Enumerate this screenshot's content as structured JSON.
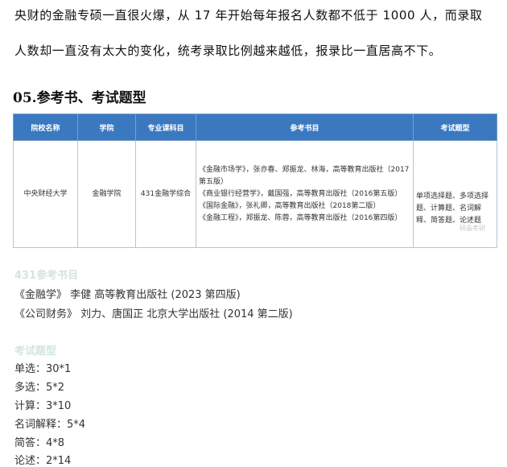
{
  "intro": {
    "line1": "央财的金融专硕一直很火爆，从 17 年开始每年报名人数都不低于 1000 人，而录取",
    "line2": "人数却一直没有太大的变化，统考录取比例越来越低，报录比一直居高不下。"
  },
  "section_title": "05.参考书、考试题型",
  "table": {
    "headers": [
      "院校名称",
      "学院",
      "专业课科目",
      "参考书目",
      "考试题型"
    ],
    "row": {
      "school": "中央财经大学",
      "college": "金融学院",
      "subject": "431金融学综合",
      "books": [
        "《金融市场学》，张亦春、郑振龙、林海，高等教育出版社（2017第五版）",
        "《商业银行经营学》，戴国强，高等教育出版社（2016第五版）",
        "《国际金融》，张礼卿，高等教育出版社（2018第二版）",
        "《金融工程》，郑振龙、陈蓉，高等教育出版社（2016第四版）"
      ],
      "types": "单项选择题、多项选择题、计算题、名词解释、简答题、论述题",
      "watermark": "研晶考研"
    }
  },
  "ref_books": {
    "heading": "431参考书目",
    "items": [
      "《金融学》 李健 高等教育出版社 (2023 第四版)",
      "《公司财务》 刘力、唐国正 北京大学出版社 (2014 第二版)"
    ]
  },
  "exam_types": {
    "heading": "考试题型",
    "items": [
      "单选：30*1",
      "多选：5*2",
      "计算：3*10",
      "名词解释：5*4",
      "简答：4*8",
      "论述：2*14"
    ]
  }
}
